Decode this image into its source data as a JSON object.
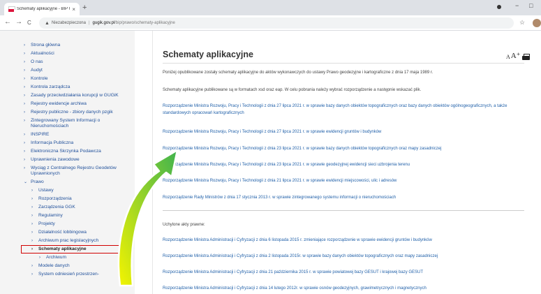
{
  "browser": {
    "tab_title": "Schematy aplikacyjne - BIP GUGiK",
    "tab_close": "×",
    "new_tab": "+",
    "window_minimize": "−",
    "window_maximize": "□",
    "back": "←",
    "forward": "→",
    "reload": "C",
    "security_label": "Niezabezpieczona",
    "url_separator": "|",
    "url_host": "gugik.gov.pl",
    "url_path": "/bip/prawo/schematy-aplikacyjne",
    "bookmark_star": "☆"
  },
  "sidebar": {
    "items": [
      {
        "label": "Strona główna",
        "level": 0,
        "chevron": "›"
      },
      {
        "label": "Aktualności",
        "level": 0,
        "chevron": "›"
      },
      {
        "label": "O nas",
        "level": 0,
        "chevron": "›"
      },
      {
        "label": "Audyt",
        "level": 0,
        "chevron": "›"
      },
      {
        "label": "Kontrole",
        "level": 0,
        "chevron": "›"
      },
      {
        "label": "Kontrola zarządcza",
        "level": 0,
        "chevron": "›"
      },
      {
        "label": "Zasady przeciwdziałania korupcji w GUGiK",
        "level": 0,
        "chevron": "›"
      },
      {
        "label": "Rejestry ewidencje archiwa",
        "level": 0,
        "chevron": "›"
      },
      {
        "label": "Rejestry publiczne - zbiory danych pzgik",
        "level": 0,
        "chevron": "›"
      },
      {
        "label": "Zintegrowany System Informacji o Nieruchomościach",
        "level": 0,
        "chevron": "›"
      },
      {
        "label": "INSPIRE",
        "level": 0,
        "chevron": "›"
      },
      {
        "label": "Informacja Publiczna",
        "level": 0,
        "chevron": "›"
      },
      {
        "label": "Elektroniczna Skrzynka Podawcza",
        "level": 0,
        "chevron": "›"
      },
      {
        "label": "Uprawnienia zawodowe",
        "level": 0,
        "chevron": "›"
      },
      {
        "label": "Wyciąg z Centralnego Rejestru Geodetów Uprawnionych",
        "level": 0,
        "chevron": "›"
      },
      {
        "label": "Prawo",
        "level": 0,
        "chevron": "⌄"
      },
      {
        "label": "Ustawy",
        "level": 1,
        "chevron": "›"
      },
      {
        "label": "Rozporządzenia",
        "level": 1,
        "chevron": "›"
      },
      {
        "label": "Zarządzenia GGK",
        "level": 1,
        "chevron": "›"
      },
      {
        "label": "Regulaminy",
        "level": 1,
        "chevron": "›"
      },
      {
        "label": "Projekty",
        "level": 1,
        "chevron": "›"
      },
      {
        "label": "Działalność lobbingowa",
        "level": 1,
        "chevron": "›"
      },
      {
        "label": "Archiwum prac legislacyjnych",
        "level": 1,
        "chevron": "›"
      },
      {
        "label": "Schematy aplikacyjne",
        "level": 1,
        "chevron": "›",
        "active": true
      },
      {
        "label": "Archiwum",
        "level": 2,
        "chevron": "›"
      },
      {
        "label": "Modele danych",
        "level": 1,
        "chevron": "›"
      },
      {
        "label": "System odniesień przestrzen-",
        "level": 1,
        "chevron": "›"
      }
    ]
  },
  "content": {
    "title": "Schematy aplikacyjne",
    "font_small": "A",
    "font_large": "A⁺",
    "intro": "Poniżej opublikowane zostały schematy aplikacyjne do aktów wykonawczych do ustawy Prawo geodezyjne i kartograficzne z dnia 17 maja 1989 r.",
    "format_note": "Schematy aplikacyjne publikowane są w formatach xsd oraz eap. W celu pobrania należy wybrać rozporządzenie a następnie wskazać plik.",
    "links": [
      "Rozporządzenie Ministra Rozwoju, Pracy i Technologii z dnia 27 lipca 2021 r. w sprawie bazy danych obiektów topograficznych oraz bazy danych obiektów ogólnogeograficznych, a także standardowych opracowań kartograficznych",
      "Rozporządzenie Ministra Rozwoju, Pracy i Technologii z dnia 27 lipca 2021 r. w sprawie ewidencji gruntów i budynków",
      "Rozporządzenie Ministra Rozwoju, Pracy i Technologii z dnia 23 lipca 2021 r. w sprawie bazy danych obiektów topograficznych oraz mapy zasadniczej",
      "Rozporządzenie Ministra Rozwoju, Pracy i Technologii z dnia 23 lipca 2021 r. w sprawie geodezyjnej ewidencji sieci uzbrojenia terenu",
      "Rozporządzenie Ministra Rozwoju, Pracy i Technologii z dnia 21 lipca 2021 r. w sprawie ewidencji miejscowości, ulic i adresów",
      "Rozporządzenie Rady Ministrów z dnia 17 stycznia 2013 r. w sprawie zintegrowanego systemu informacji o nieruchomościach"
    ],
    "repealed_heading": "Uchylone akty prawne:",
    "repealed_links": [
      "Rozporządzenie Ministra Administracji i Cyfryzacji z dnia 6 listopada 2015 r. zmieniające rozporządzenie w sprawie ewidencji gruntów i budynków",
      "Rozporządzenie Ministra Administracji i Cyfryzacji z dnia 2 listopada 2015r. w sprawie bazy danych obiektów topograficznych oraz mapy zasadniczej",
      "Rozporządzenie Ministra Administracji i Cyfryzacji z dnia 21 października 2015 r. w sprawie powiatowej bazy GESUT i krajowej bazy GESUT",
      "Rozporządzenie Ministra Administracji i Cyfryzacji z dnia 14 lutego 2012r. w sprawie osnów geodezyjnych, grawimetrycznych i magnetycznych"
    ]
  },
  "colors": {
    "link": "#1f5fa8",
    "highlight_box": "#d10000",
    "arrow_start": "#f4f400",
    "arrow_end": "#3fb34f"
  }
}
